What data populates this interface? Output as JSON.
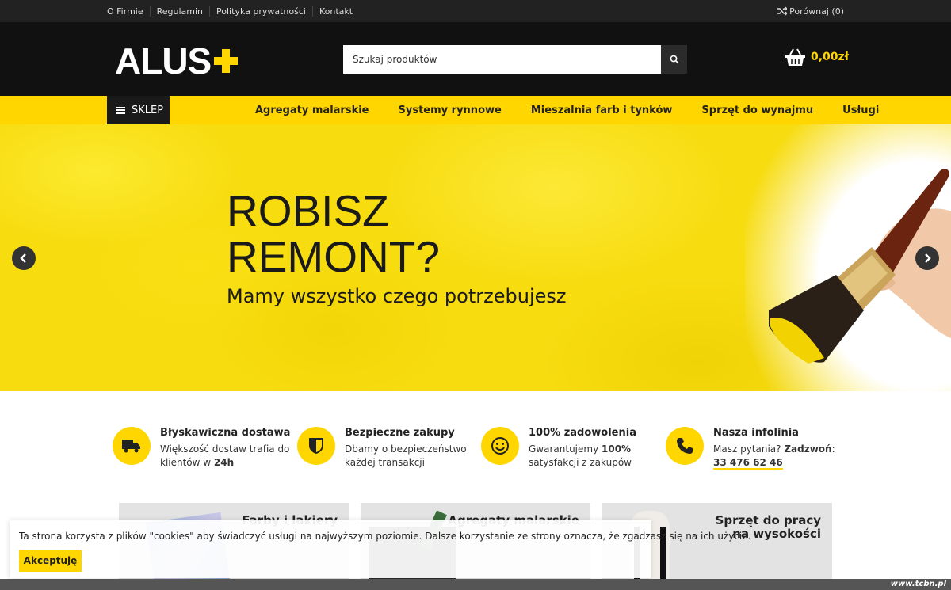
{
  "topbar": {
    "links": [
      "O Firmie",
      "Regulamin",
      "Polityka prywatności",
      "Kontakt"
    ],
    "compare_label": "Porównaj (0)",
    "compare_icon": "shuffle-icon"
  },
  "header": {
    "logo_text": "ALUS",
    "search_placeholder": "Szukaj produktów",
    "cart_total": "0,00zł",
    "cart_icon": "basket-icon",
    "search_icon": "search-icon"
  },
  "nav": {
    "shop_label": "SKLEP",
    "links": [
      "Agregaty malarskie",
      "Systemy rynnowe",
      "Mieszalnia farb i tynków",
      "Sprzęt do wynajmu",
      "Usługi"
    ]
  },
  "hero": {
    "title_line1": "ROBISZ",
    "title_line2": "REMONT?",
    "subtitle": "Mamy wszystko czego potrzebujesz"
  },
  "features": [
    {
      "title": "Błyskawiczna dostawa",
      "line1": "Większość dostaw trafia do",
      "line2_pre": "klientów w ",
      "line2_bold": "24h",
      "icon": "truck-icon"
    },
    {
      "title": "Bezpieczne zakupy",
      "line1": "Dbamy o bezpieczeństwo",
      "line2_pre": "każdej transakcji",
      "line2_bold": "",
      "icon": "shield-icon"
    },
    {
      "title": "100% zadowolenia",
      "line1_pre": "Gwarantujemy ",
      "line1_bold": "100%",
      "line2_pre": "satysfakcji z zakupów",
      "icon": "smile-icon"
    },
    {
      "title": "Nasza infolinia",
      "line1_pre": "Masz pytania? ",
      "line1_bold": "Zadzwoń",
      "line1_post": ":",
      "phone": "33 476 62 46",
      "icon": "phone-icon"
    }
  ],
  "tiles": [
    {
      "name": "Farby i lakiery"
    },
    {
      "name": "Agregaty malarskie"
    },
    {
      "name_line1": "Sprzęt do pracy",
      "name_line2": "na wysokości"
    }
  ],
  "cookie": {
    "text": "Ta strona korzysta z plików \"cookies\" aby świadczyć usługi na najwyższym poziomie. Dalsze korzystanie ze strony oznacza, że zgadzasz się na ich użycie.",
    "accept_label": "Akceptuję"
  },
  "watermark": "www.tcbn.pl",
  "colors": {
    "accent": "#ffd600",
    "dark": "#111111"
  }
}
